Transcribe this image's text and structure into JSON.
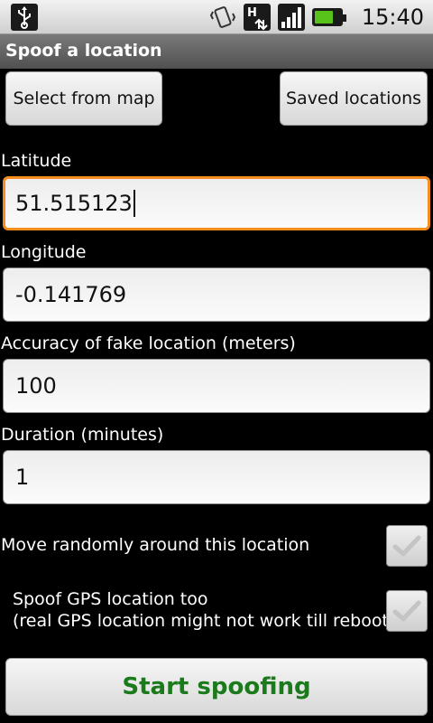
{
  "status_bar": {
    "time": "15:40",
    "icons": [
      "usb-icon",
      "vibrate-icon",
      "hspa-data-icon",
      "signal-icon",
      "battery-charging-icon"
    ],
    "battery_level": 0.75,
    "battery_color": "#59c21a"
  },
  "title_bar": {
    "title": "Spoof a location"
  },
  "buttons": {
    "select_from_map": "Select from map",
    "saved_locations": "Saved locations",
    "start": "Start spoofing"
  },
  "fields": {
    "latitude": {
      "label": "Latitude",
      "value": "51.515123"
    },
    "longitude": {
      "label": "Longitude",
      "value": "-0.141769"
    },
    "accuracy": {
      "label": "Accuracy of fake location (meters)",
      "value": "100"
    },
    "duration": {
      "label": "Duration (minutes)",
      "value": "1"
    }
  },
  "checkboxes": {
    "move_randomly": {
      "label": "Move randomly around this location",
      "checked": false
    },
    "spoof_gps": {
      "label_line1": "Spoof GPS location too",
      "label_line2": "(real GPS location might not work till reboot)",
      "checked": false
    }
  },
  "colors": {
    "focus_border": "#f58c1e",
    "start_text": "#1b7a1b",
    "title_bar_bg": "#5e5e5e"
  }
}
